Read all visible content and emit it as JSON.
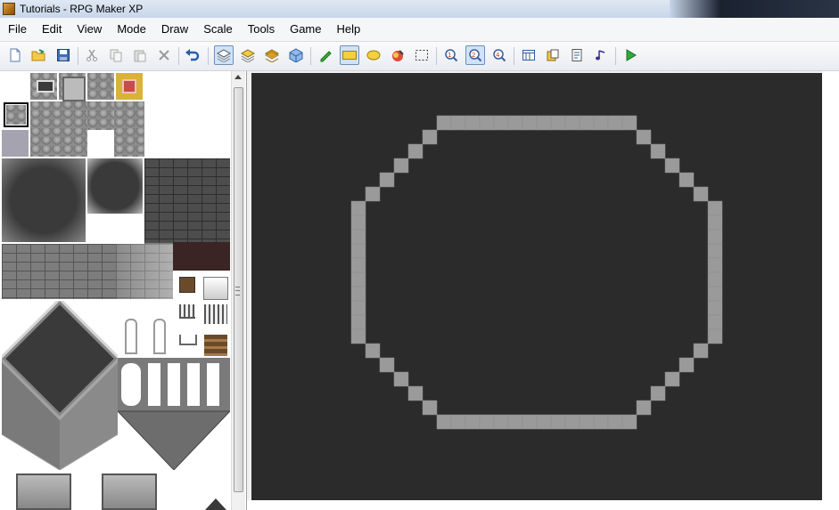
{
  "window": {
    "title": "Tutorials - RPG Maker XP"
  },
  "menu": [
    "File",
    "Edit",
    "View",
    "Mode",
    "Draw",
    "Scale",
    "Tools",
    "Game",
    "Help"
  ],
  "toolbar": {
    "buttons": [
      {
        "name": "new-project-icon",
        "active": false
      },
      {
        "name": "open-project-icon",
        "active": false
      },
      {
        "name": "save-project-icon",
        "active": false
      },
      {
        "name": "cut-icon",
        "active": false
      },
      {
        "name": "copy-icon",
        "active": false
      },
      {
        "name": "paste-icon",
        "active": false
      },
      {
        "name": "delete-icon",
        "active": false
      },
      {
        "name": "undo-icon",
        "active": false
      },
      {
        "name": "layer-1-icon",
        "active": true
      },
      {
        "name": "layer-2-icon",
        "active": false
      },
      {
        "name": "layer-3-icon",
        "active": false
      },
      {
        "name": "events-layer-icon",
        "active": false
      },
      {
        "name": "pencil-icon",
        "active": false
      },
      {
        "name": "rectangle-icon",
        "active": true
      },
      {
        "name": "ellipse-icon",
        "active": false
      },
      {
        "name": "flood-fill-icon",
        "active": false
      },
      {
        "name": "select-icon",
        "active": false
      },
      {
        "name": "zoom-1-1-icon",
        "active": false
      },
      {
        "name": "zoom-1-2-icon",
        "active": true
      },
      {
        "name": "zoom-1-4-icon",
        "active": false
      },
      {
        "name": "database-icon",
        "active": false
      },
      {
        "name": "materialbase-icon",
        "active": false
      },
      {
        "name": "script-editor-icon",
        "active": false
      },
      {
        "name": "sound-test-icon",
        "active": false
      },
      {
        "name": "playtest-icon",
        "active": false
      }
    ]
  },
  "colors": {
    "map_bg": "#2b2b2b",
    "wall": "#9a9a9a",
    "selected_tool_bg": "#cfe3f8"
  }
}
